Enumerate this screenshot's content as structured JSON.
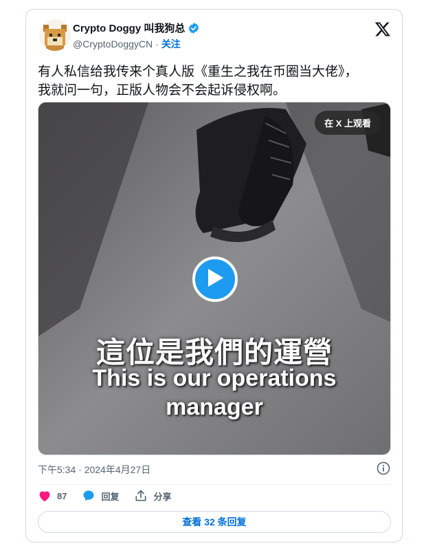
{
  "author": {
    "name": "Crypto Doggy 叫我狗总",
    "handle": "@CryptoDoggyCN",
    "separator": "·",
    "follow_label": "关注"
  },
  "tweet": {
    "text": "有人私信给我传来个真人版《重生之我在币圈当大佬》，\n我就问一句，正版人物会不会起诉侵权啊。"
  },
  "media": {
    "watch_on_x_label": "在 X 上观看",
    "subtitle_cn": "這位是我們的運營",
    "subtitle_en": "This is our operations\nmanager"
  },
  "meta": {
    "timestamp": "下午5:34 · 2024年4月27日"
  },
  "actions": {
    "like_count": "87",
    "reply_label": "回复",
    "share_label": "分享"
  },
  "replies_button": {
    "label": "查看 32 条回复"
  },
  "colors": {
    "accent": "#1d9bf0",
    "link": "#006fd6",
    "like": "#f91880",
    "secondary_text": "#536471"
  },
  "icons": [
    "verified-badge-icon",
    "x-logo-icon",
    "play-icon",
    "info-icon",
    "heart-icon",
    "reply-bubble-icon",
    "share-icon"
  ]
}
